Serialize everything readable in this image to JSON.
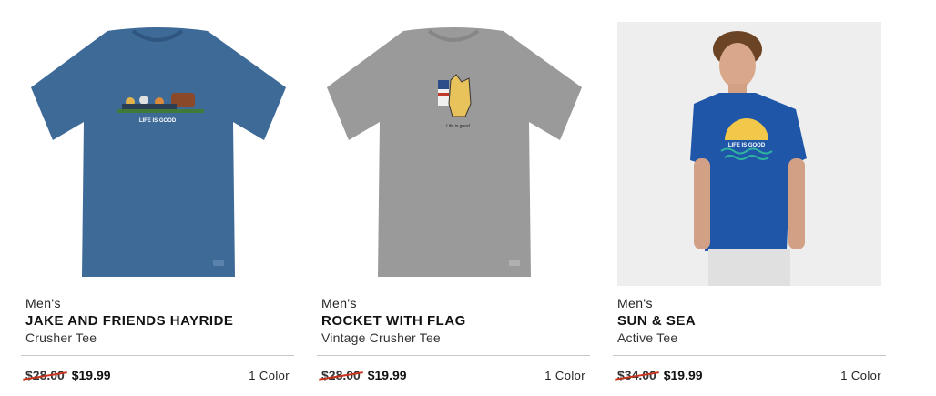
{
  "products": [
    {
      "gender": "Men's",
      "name": "JAKE AND FRIENDS HAYRIDE",
      "style": "Crusher Tee",
      "original_price": "$28.00",
      "sale_price": "$19.99",
      "colors": "1 Color",
      "shirt_color": "#3e6a98",
      "graphic_text": "LIFE IS GOOD"
    },
    {
      "gender": "Men's",
      "name": "ROCKET WITH FLAG",
      "style": "Vintage Crusher Tee",
      "original_price": "$28.00",
      "sale_price": "$19.99",
      "colors": "1 Color",
      "shirt_color": "#9a9a9a",
      "graphic_text": "Life is good"
    },
    {
      "gender": "Men's",
      "name": "SUN & SEA",
      "style": "Active Tee",
      "original_price": "$34.00",
      "sale_price": "$19.99",
      "colors": "1 Color",
      "shirt_color": "#1f56a8",
      "graphic_text": "LIFE IS GOOD"
    }
  ],
  "colors": {
    "strike": "#c8341f",
    "divider": "#c8c8c8",
    "photo_bg": "#eeeeee"
  }
}
